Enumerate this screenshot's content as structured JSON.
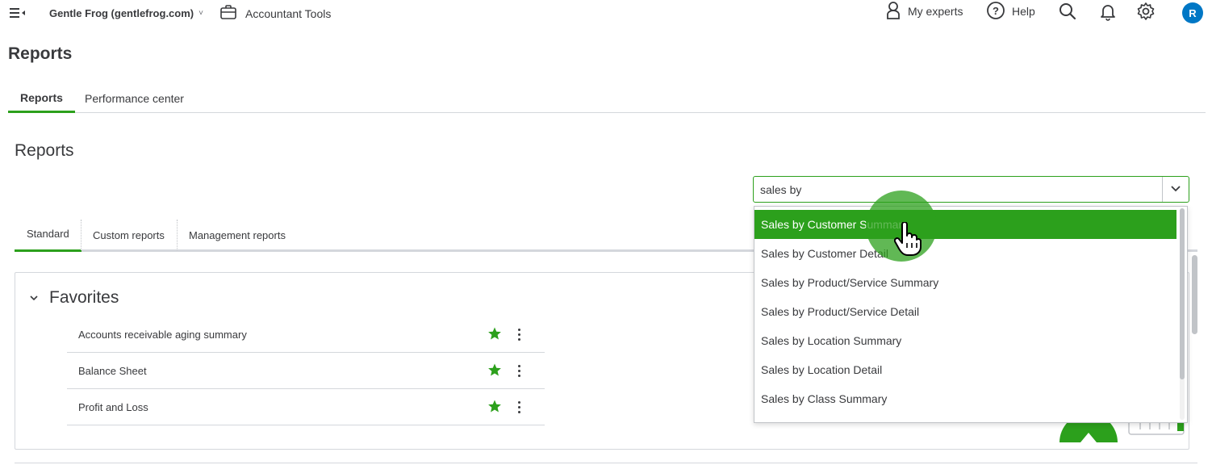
{
  "header": {
    "company_name": "Gentle Frog (gentlefrog.com)",
    "company_chevron": "˅",
    "accountant_tools": "Accountant Tools",
    "my_experts": "My experts",
    "help": "Help",
    "avatar_initial": "R"
  },
  "page": {
    "title": "Reports",
    "tabs": [
      {
        "label": "Reports"
      },
      {
        "label": "Performance center"
      }
    ]
  },
  "reports": {
    "section_title": "Reports",
    "search": {
      "value": "sales by",
      "suggestions": [
        "Sales by Customer Summary",
        "Sales by Customer Detail",
        "Sales by Product/Service Summary",
        "Sales by Product/Service Detail",
        "Sales by Location Summary",
        "Sales by Location Detail",
        "Sales by Class Summary"
      ]
    },
    "tabs": [
      {
        "label": "Standard"
      },
      {
        "label": "Custom reports"
      },
      {
        "label": "Management reports"
      }
    ],
    "favorites": {
      "title": "Favorites",
      "items": [
        {
          "label": "Accounts receivable aging summary"
        },
        {
          "label": "Balance Sheet"
        },
        {
          "label": "Profit and Loss"
        }
      ]
    }
  },
  "colors": {
    "brand_green": "#2ca01c",
    "text": "#393a3d",
    "border": "#d4d7dc",
    "avatar_blue": "#0077c5"
  }
}
